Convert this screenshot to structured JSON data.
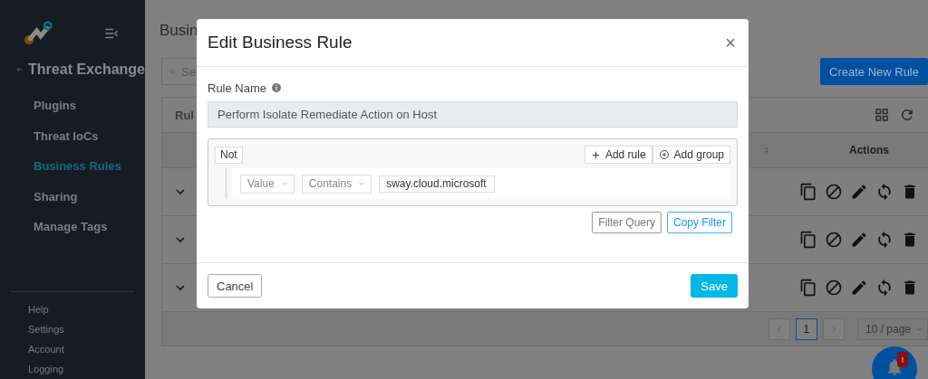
{
  "sidebar": {
    "back_title": "Threat Exchange",
    "items": [
      {
        "label": "Plugins",
        "selected": false
      },
      {
        "label": "Threat IoCs",
        "selected": false
      },
      {
        "label": "Business Rules",
        "selected": true
      },
      {
        "label": "Sharing",
        "selected": false
      },
      {
        "label": "Manage Tags",
        "selected": false
      }
    ],
    "footer_links": [
      "Help",
      "Settings",
      "Account",
      "Logging"
    ]
  },
  "page": {
    "title": "Busin",
    "search": {
      "placeholder": "Se"
    },
    "create_button": "Create New Rule",
    "table": {
      "header": "Rul",
      "actions_column": "Actions",
      "rows": [
        {
          "expanded": false
        },
        {
          "expanded": false
        },
        {
          "expanded": false
        }
      ]
    },
    "pagination": {
      "pages": [
        {
          "label": "1",
          "selected": true
        }
      ],
      "page_size": "10 / page"
    },
    "notification_badge": "!"
  },
  "modal": {
    "title": "Edit Business Rule",
    "close": "×",
    "rule_name_label": "Rule Name",
    "rule_name_value": "Perform Isolate Remediate Action on Host",
    "query": {
      "not": {
        "label": "Not",
        "on": false
      },
      "add_rule": "Add rule",
      "add_group": "Add group",
      "rules": [
        {
          "field": "Value",
          "operator": "Contains",
          "value": "sway.cloud.microsoft"
        }
      ]
    },
    "filter_query": "Filter Query",
    "copy_filter": "Copy Filter",
    "cancel": "Cancel",
    "save": "Save"
  }
}
